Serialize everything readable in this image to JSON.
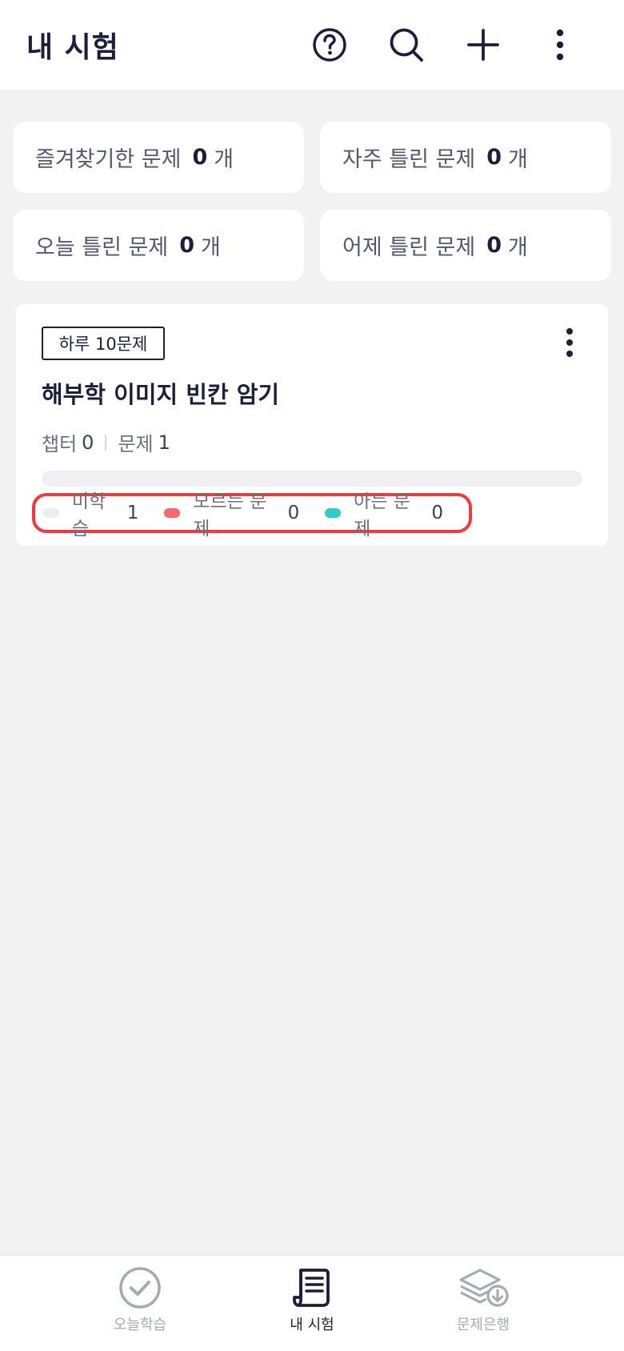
{
  "header": {
    "title": "내 시험",
    "icons": [
      "help-icon",
      "search-icon",
      "plus-icon",
      "more-vertical-icon"
    ]
  },
  "stats": [
    {
      "label": "즐겨찾기한 문제",
      "count": "0",
      "unit": "개"
    },
    {
      "label": "자주 틀린 문제",
      "count": "0",
      "unit": "개"
    },
    {
      "label": "오늘 틀린 문제",
      "count": "0",
      "unit": "개"
    },
    {
      "label": "어제 틀린 문제",
      "count": "0",
      "unit": "개"
    }
  ],
  "exam_card": {
    "badge": "하루 10문제",
    "title": "해부학 이미지 빈칸 암기",
    "chapter_label": "챕터",
    "chapter_count": "0",
    "question_label": "문제",
    "question_count": "1",
    "progress_known_fraction": 0,
    "legend": [
      {
        "label": "미학습",
        "count": "1",
        "color": "#ededed"
      },
      {
        "label": "모르는 문제",
        "count": "0",
        "color": "#f7696d"
      },
      {
        "label": "아는 문제",
        "count": "0",
        "color": "#2dcdc6"
      }
    ],
    "highlight_color": "#f23a3c"
  },
  "bottom_nav": [
    {
      "label": "오늘학습",
      "icon": "check-circle-icon",
      "active": false
    },
    {
      "label": "내 시험",
      "icon": "scroll-icon",
      "active": true
    },
    {
      "label": "문제은행",
      "icon": "layers-download-icon",
      "active": false
    }
  ],
  "colors": {
    "primary": "#1c1f3a",
    "background": "#f2f2f2",
    "inactive": "#a7a9b4"
  }
}
